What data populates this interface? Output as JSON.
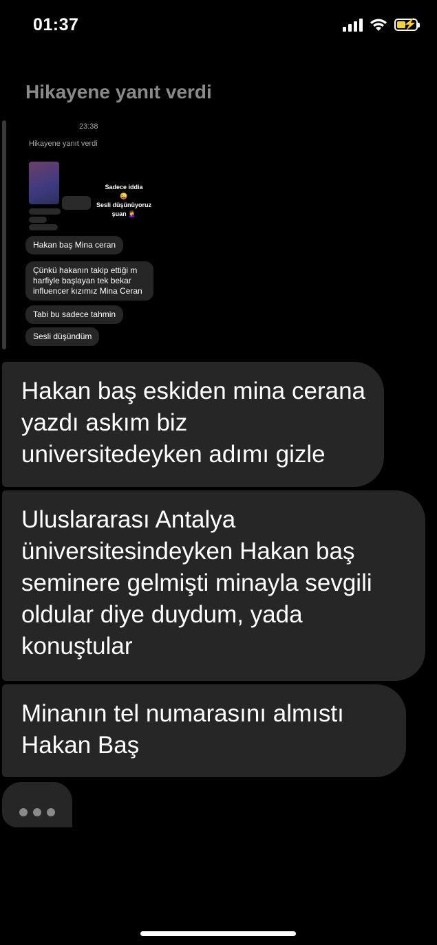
{
  "status_bar": {
    "time": "01:37",
    "battery_color": "#f3d33a"
  },
  "reply_header": "Hikayene yanıt verdi",
  "embedded_screenshot": {
    "time": "23:38",
    "header": "Hikayene yanıt verdi",
    "story_text_lines": [
      "Sadece iddia",
      "😜",
      "Sesli düşünüyoruz",
      "şuan 🤦‍♀️"
    ],
    "messages": [
      "Hakan baş Mina ceran",
      "Çünkü hakanın takip ettiği m harfiyle başlayan tek bekar influencer kızımız Mina Ceran",
      "Tabi bu sadece tahmin",
      "Sesli düşündüm"
    ]
  },
  "messages": [
    "Hakan baş eskiden mina cerana yazdı askım biz universitedeyken adımı gizle",
    "Uluslararası Antalya üniversitesindeyken Hakan baş seminere gelmişti minayla sevgili oldular diye duydum, yada konuştular",
    "Minanın tel numarasını almıstı Hakan Baş"
  ],
  "colors": {
    "background": "#000000",
    "bubble": "#262626",
    "muted_text": "#8a8a8a"
  },
  "icons": [
    "signal-icon",
    "wifi-icon",
    "battery-icon",
    "typing-indicator-icon"
  ]
}
